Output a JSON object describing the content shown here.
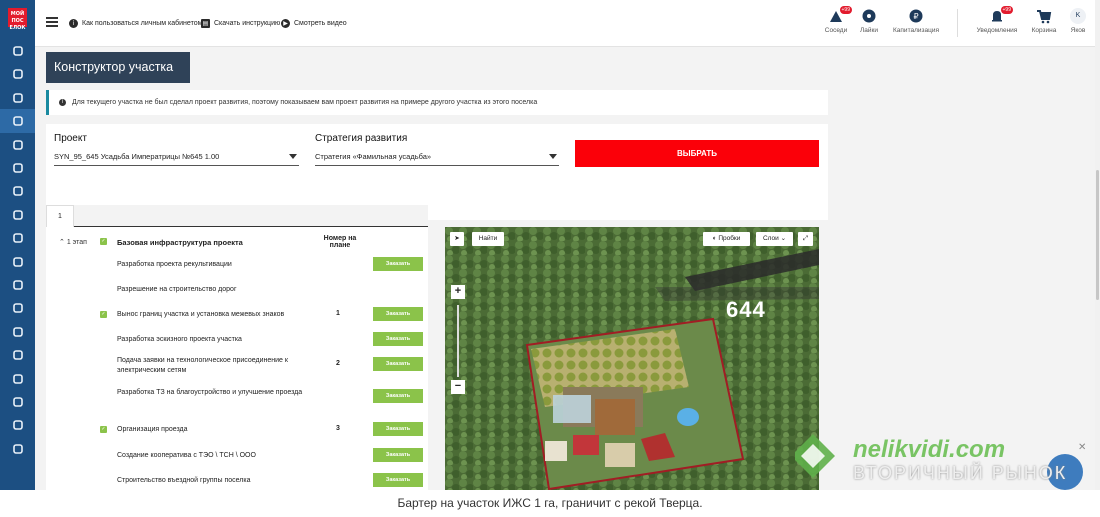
{
  "sidebar": {
    "logo": "МОЙ ПОСЕЛОК",
    "items": [
      "grid-icon",
      "user-icon",
      "compass-icon",
      "upload-icon",
      "target-icon",
      "chart-line-icon",
      "bar-chart-icon",
      "briefcase-icon",
      "cart-icon",
      "exchange-icon",
      "copy-icon",
      "document-icon",
      "checklist-icon",
      "book-icon",
      "building-icon",
      "megaphone-icon",
      "phone-icon",
      "exit-icon"
    ]
  },
  "topbar": {
    "links": [
      "Как пользоваться личным кабинетом?",
      "Скачать инструкцию",
      "Смотреть видео"
    ],
    "neighbors": "Соседи",
    "neighbors_badge": "+99",
    "likes": "Лайки",
    "capitalization": "Капитализация",
    "notifications": "Уведомления",
    "notifications_badge": "+99",
    "cart": "Корзина",
    "user_initial": "K",
    "user_name": "Яков"
  },
  "page_title": "Конструктор участка",
  "info_text": "Для текущего участка не был сделал проект развития, поэтому показываем вам проект развития на примере другого участка из этого поселка",
  "form": {
    "project_label": "Проект",
    "project_value": "SYN_95_645 Усадьба Императрицы №645 1.00",
    "strategy_label": "Стратегия развития",
    "strategy_value": "Стратегия «Фамильная усадьба»",
    "choose_button": "ВЫБРАТЬ"
  },
  "tab_label": "1",
  "table": {
    "stage": "1 этап",
    "header_title": "Базовая инфраструктура проекта",
    "header_num": "Номер на плане",
    "rows": [
      {
        "text": "Разработка проекта рекультивации",
        "num": "",
        "checked": false,
        "button": "Заказать"
      },
      {
        "text": "Разрешение на строительство дорог",
        "num": "",
        "checked": false,
        "button": ""
      },
      {
        "text": "Вынос границ участка и установка межевых знаков",
        "num": "1",
        "checked": true,
        "button": "Заказать"
      },
      {
        "text": "Разработка эскизного проекта участка",
        "num": "",
        "checked": false,
        "button": "Заказать"
      },
      {
        "text": "Подача заявки на технологическое присоединение к электрическим сетям",
        "num": "2",
        "checked": false,
        "button": "Заказать"
      },
      {
        "text": "Разработка ТЗ на благоустройство и улучшение проезда",
        "num": "",
        "checked": false,
        "button": "Заказать"
      },
      {
        "text": "Организация проезда",
        "num": "3",
        "checked": true,
        "button": "Заказать"
      },
      {
        "text": "Создание кооператива с ТЭО \\ ТСН \\ ООО",
        "num": "",
        "checked": false,
        "button": "Заказать"
      },
      {
        "text": "Строительство въездной группы поселка",
        "num": "",
        "checked": false,
        "button": "Заказать"
      }
    ]
  },
  "map": {
    "find": "Найти",
    "traffic": "Пробки",
    "layers": "Слои",
    "zoom_in": "+",
    "zoom_out": "−",
    "plot_number": "644"
  },
  "watermark": {
    "brand": "nelikvidi.com",
    "tagline": "ВТОРИЧНЫЙ РЫНОК"
  },
  "caption": "Бартер на участок ИЖС 1 га, граничит с рекой Тверца."
}
